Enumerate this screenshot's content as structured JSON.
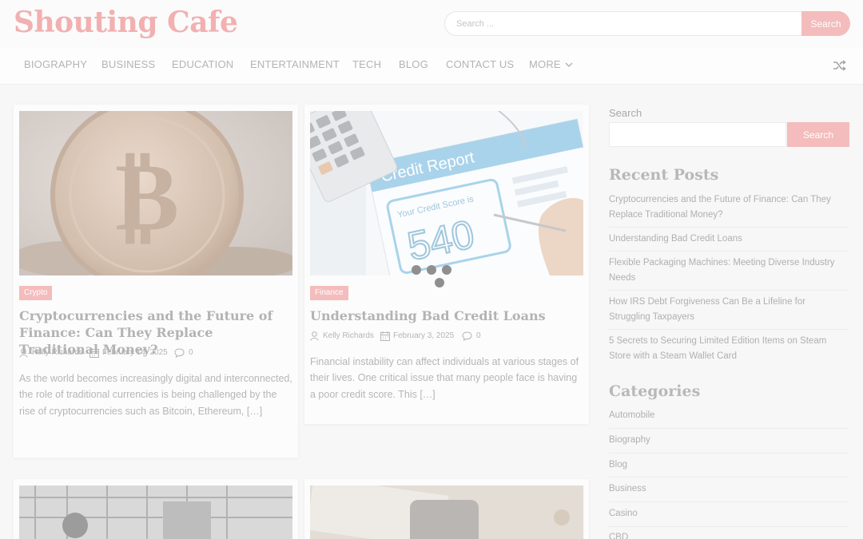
{
  "site": {
    "title": "Shouting Cafe"
  },
  "header_search": {
    "placeholder": "Search ...",
    "button": "Search"
  },
  "nav": {
    "items": [
      "BIOGRAPHY",
      "BUSINESS",
      "EDUCATION",
      "ENTERTAINMENT",
      "TECH",
      "BLOG",
      "CONTACT US",
      "MORE"
    ],
    "more_icon": "chevron-down-icon",
    "shuffle_icon": "shuffle-icon"
  },
  "posts": [
    {
      "category": "Crypto",
      "title": "Cryptocurrencies and the Future of Finance: Can They Replace Traditional Money?",
      "author": "Kelly Richards",
      "date": "February 14, 2025",
      "comments": "0",
      "excerpt": "As the world becomes increasingly digital and interconnected, the role of traditional currencies is being challenged by the rise of cryptocurrencies such as Bitcoin, Ethereum, […]"
    },
    {
      "category": "Finance",
      "title": "Understanding Bad Credit Loans",
      "author": "Kelly Richards",
      "date": "February 3, 2025",
      "comments": "0",
      "excerpt": "Financial instability can affect individuals at various stages of their lives. One critical issue that many people face is having a poor credit score. This […]",
      "image_text": {
        "report": "Credit Report",
        "score_label": "Your Credit Score is",
        "score": "540"
      }
    }
  ],
  "sidebar": {
    "search_label": "Search",
    "search_button": "Search",
    "recent_title": "Recent Posts",
    "recent_posts": [
      "Cryptocurrencies and the Future of Finance: Can They Replace Traditional Money?",
      "Understanding Bad Credit Loans",
      "Flexible Packaging Machines: Meeting Diverse Industry Needs",
      "How IRS Debt Forgiveness Can Be a Lifeline for Struggling Taxpayers",
      "5 Secrets to Securing Limited Edition Items on Steam Store with a Steam Wallet Card"
    ],
    "categories_title": "Categories",
    "categories": [
      "Automobile",
      "Biography",
      "Blog",
      "Business",
      "Casino",
      "CBD"
    ]
  },
  "colors": {
    "accent": "#f4bcbc",
    "logo": "#f2b0b0",
    "background": "#f7f7f7"
  }
}
